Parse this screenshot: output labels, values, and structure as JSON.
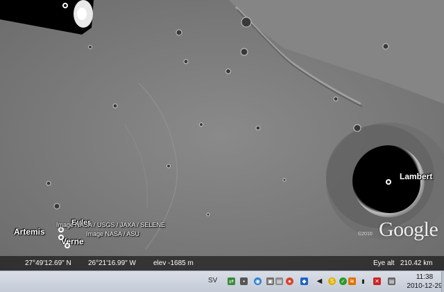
{
  "map": {
    "labels": {
      "lambert": "Lambert",
      "artemis": "Artemis",
      "euler": "Euler",
      "verne": "Verne"
    },
    "credits": {
      "line1": "Image NASA / USGS / JAXA / SELENE",
      "line2": "Image NASA / ASU"
    },
    "logo": "Google",
    "copyright": "©2010"
  },
  "status": {
    "latitude": "27°49'12.69\" N",
    "longitude": "26°21'16.99\" W",
    "elevation": "elev -1685 m",
    "eye_alt": "Eye alt   210.42 km"
  },
  "taskbar": {
    "language": "SV",
    "time": "11:38",
    "date": "2010-12-29",
    "tray_icons": [
      "network-icon",
      "app-icon",
      "globe-icon",
      "security-icon",
      "drive-icon",
      "chrome-icon",
      "volume-icon",
      "skype-icon",
      "wifi-icon",
      "signal-icon",
      "flag-icon",
      "notes-icon"
    ]
  }
}
